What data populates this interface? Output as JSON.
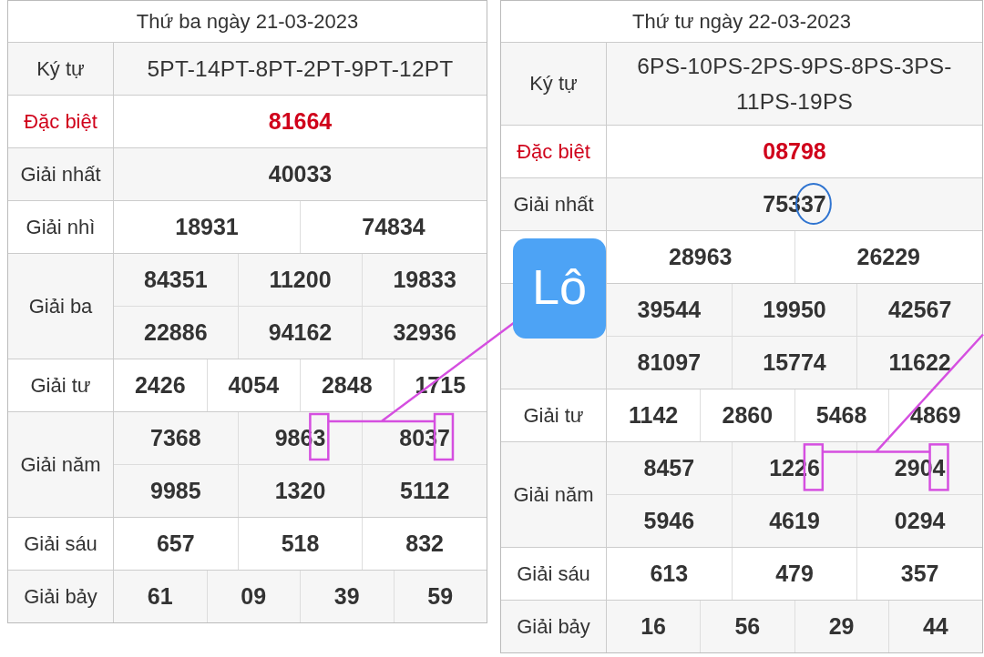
{
  "badge": "Lô",
  "days": [
    {
      "title": "Thứ ba ngày 21-03-2023",
      "to_badge": true,
      "rows": [
        {
          "kind": "code",
          "label": "Ký tự",
          "lines": [
            [
              "5PT-14PT-8PT-2PT-9PT-12PT"
            ]
          ]
        },
        {
          "kind": "special",
          "label": "Đặc biệt",
          "lines": [
            [
              "81664"
            ]
          ]
        },
        {
          "kind": "prize",
          "label": "Giải nhất",
          "lines": [
            [
              "40033"
            ]
          ]
        },
        {
          "kind": "prize",
          "label": "Giải nhì",
          "lines": [
            [
              "18931",
              "74834"
            ]
          ]
        },
        {
          "kind": "prize",
          "label": "Giải ba",
          "lines": [
            [
              "84351",
              "11200",
              "19833"
            ],
            [
              "22886",
              "94162",
              "32936"
            ]
          ]
        },
        {
          "kind": "prize",
          "label": "Giải tư",
          "lines": [
            [
              "2426",
              "4054",
              "2848",
              "1715"
            ]
          ]
        },
        {
          "kind": "prize",
          "label": "Giải năm",
          "lines": [
            [
              "7368",
              {
                "text": "9863",
                "kind": "boxed"
              },
              {
                "text": "8037",
                "kind": "boxed"
              }
            ],
            [
              "9985",
              "1320",
              "5112"
            ]
          ]
        },
        {
          "kind": "prize",
          "label": "Giải sáu",
          "lines": [
            [
              "657",
              "518",
              "832"
            ]
          ]
        },
        {
          "kind": "prize",
          "label": "Giải bảy",
          "lines": [
            [
              "61",
              "09",
              "39",
              "59"
            ]
          ]
        }
      ]
    },
    {
      "title": "Thứ tư ngày 22-03-2023",
      "to_badge": false,
      "rows": [
        {
          "kind": "code",
          "label": "Ký tự",
          "lines": [
            [
              "6PS-10PS-2PS-9PS-8PS-3PS-11PS-19PS"
            ]
          ]
        },
        {
          "kind": "special",
          "label": "Đặc biệt",
          "lines": [
            [
              "08798"
            ]
          ]
        },
        {
          "kind": "prize",
          "label": "Giải nhất",
          "lines": [
            [
              {
                "text": "75337",
                "kind": "circled"
              }
            ]
          ]
        },
        {
          "kind": "prize",
          "lines": [
            [
              "28963",
              "26229"
            ]
          ]
        },
        {
          "kind": "prize",
          "lines": [
            [
              "39544",
              "19950",
              "42567"
            ],
            [
              "81097",
              "15774",
              "11622"
            ]
          ]
        },
        {
          "kind": "prize",
          "label": "Giải tư",
          "lines": [
            [
              "1142",
              "2860",
              "5468",
              "4869"
            ]
          ]
        },
        {
          "kind": "prize",
          "label": "Giải năm",
          "lines": [
            [
              "8457",
              {
                "text": "1226",
                "kind": "boxed"
              },
              {
                "text": "2904",
                "kind": "boxed"
              }
            ],
            [
              "5946",
              "4619",
              "0294"
            ]
          ]
        },
        {
          "kind": "prize",
          "label": "Giải sáu",
          "lines": [
            [
              "613",
              "479",
              "357"
            ]
          ]
        },
        {
          "kind": "prize",
          "label": "Giải bảy",
          "lines": [
            [
              "16",
              "56",
              "29",
              "44"
            ]
          ]
        }
      ]
    }
  ]
}
